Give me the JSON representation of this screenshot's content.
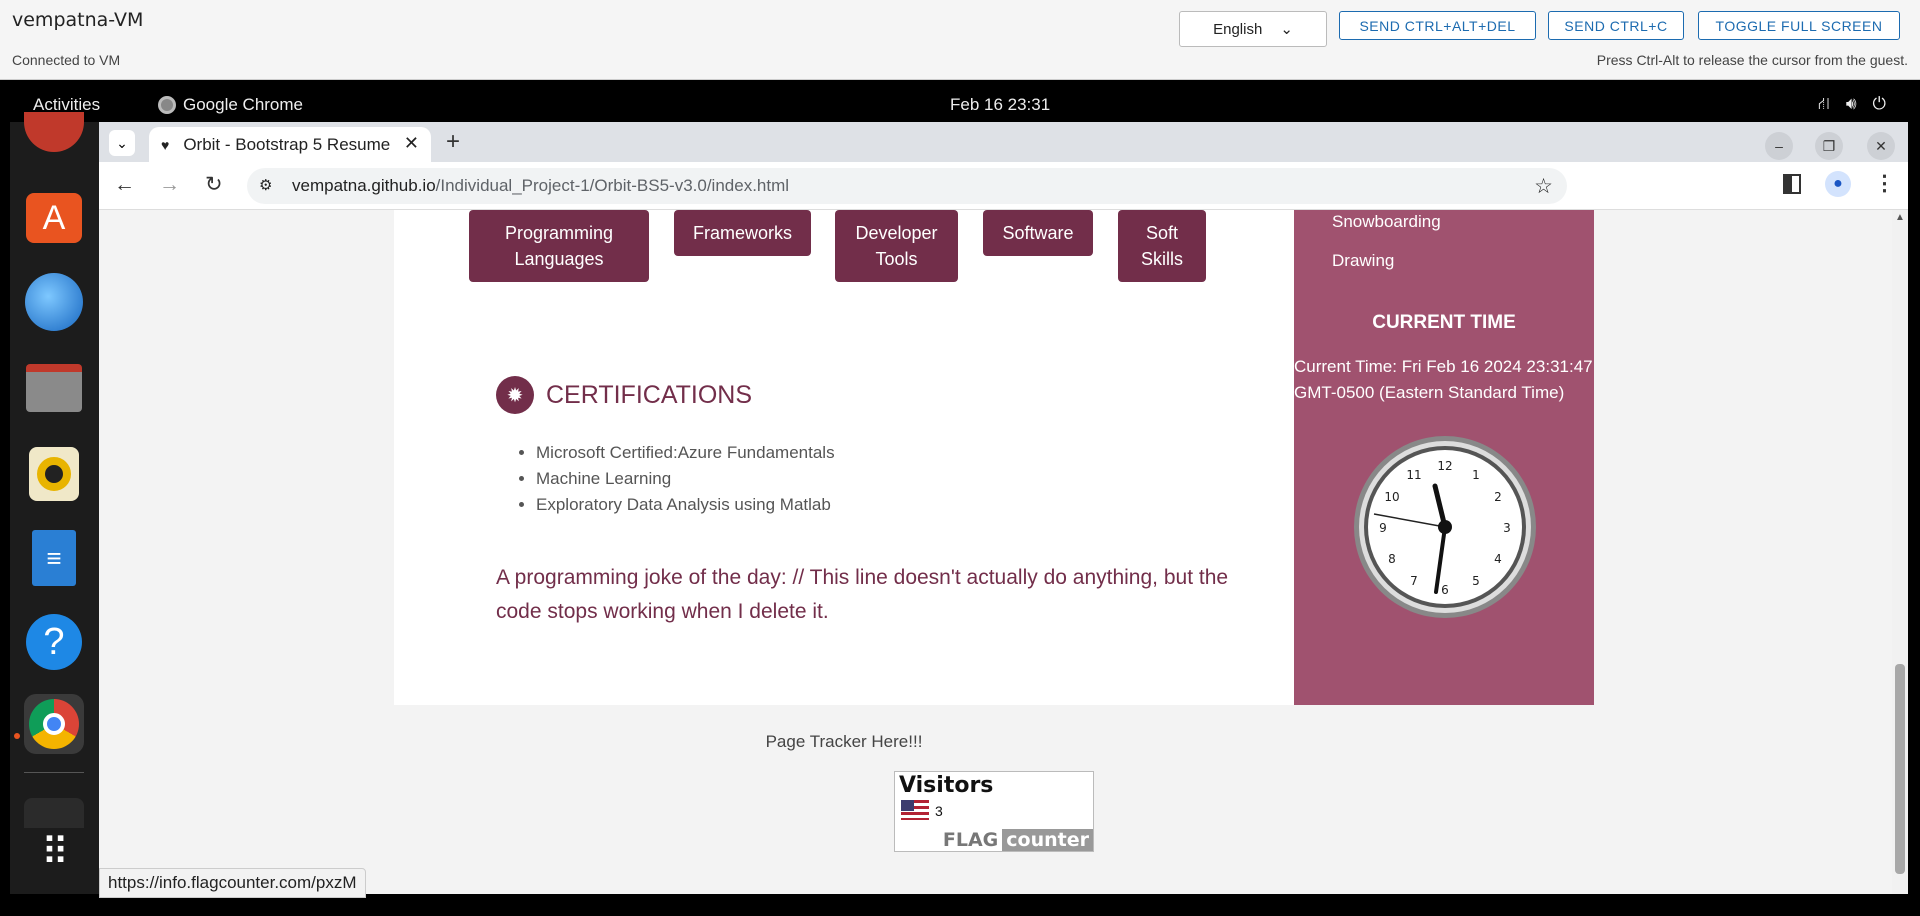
{
  "vm": {
    "title": "vempatna-VM",
    "status": "Connected to VM",
    "language": "English",
    "buttons": [
      "SEND CTRL+ALT+DEL",
      "SEND CTRL+C",
      "TOGGLE FULL SCREEN"
    ],
    "hint": "Press Ctrl-Alt to release the cursor from the guest."
  },
  "gnome": {
    "activities": "Activities",
    "app": "Google Chrome",
    "clock": "Feb 16  23:31"
  },
  "browser": {
    "tab_title": "Orbit - Bootstrap 5 Resume",
    "url_host": "vempatna.github.io",
    "url_path": "/Individual_Project-1/Orbit-BS5-v3.0/index.html",
    "status_url": "https://info.flagcounter.com/pxzM"
  },
  "page": {
    "skills": [
      "Programming Languages",
      "Frameworks",
      "Developer Tools",
      "Software",
      "Soft Skills"
    ],
    "cert_title": "CERTIFICATIONS",
    "certs": [
      "Microsoft Certified:Azure Fundamentals",
      "Machine Learning",
      "Exploratory Data Analysis using Matlab"
    ],
    "joke": "A programming joke of the day: // This line doesn't actually do anything, but the code stops working when I delete it.",
    "hobbies": [
      "Snowboarding",
      "Drawing"
    ],
    "time_heading": "CURRENT TIME",
    "time_text": "Current Time: Fri Feb 16 2024 23:31:47 GMT-0500 (Eastern Standard Time)",
    "tracker": "Page Tracker Here!!!",
    "visitors_label": "Visitors",
    "visitors_count": "3",
    "flag_brand": "FLAG",
    "flag_brand2": "counter"
  },
  "colors": {
    "accent": "#722e4a",
    "sidebar": "#a0526f",
    "vm_link": "#1c6bb0"
  }
}
